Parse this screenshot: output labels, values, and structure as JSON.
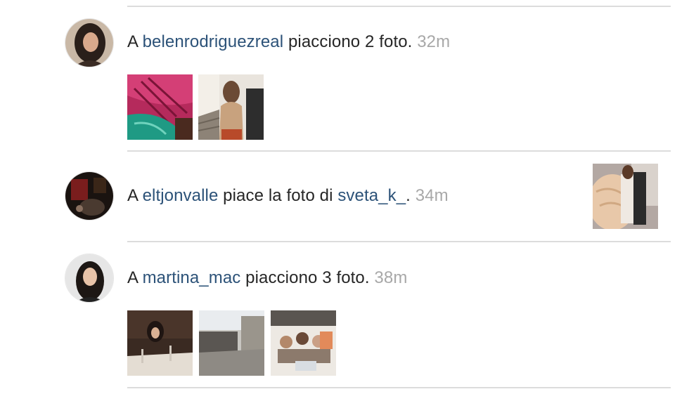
{
  "feed": [
    {
      "prefix": "A ",
      "user": "belenrodriguezreal",
      "action": " piacciono 2 foto.",
      "time": " 32m",
      "photo_count": 2
    },
    {
      "prefix": "A ",
      "user": "eltjonvalle",
      "action": " piace la foto di ",
      "target_user": "sveta_k_",
      "suffix": ".",
      "time": " 34m",
      "photo_count": 1
    },
    {
      "prefix": "A ",
      "user": "martina_mac",
      "action": " piacciono 3 foto.",
      "time": " 38m",
      "photo_count": 3
    }
  ],
  "colors": {
    "username": "#2c5278",
    "text": "#262626",
    "timestamp": "#a8a8a8",
    "divider": "#dcdcdc"
  }
}
